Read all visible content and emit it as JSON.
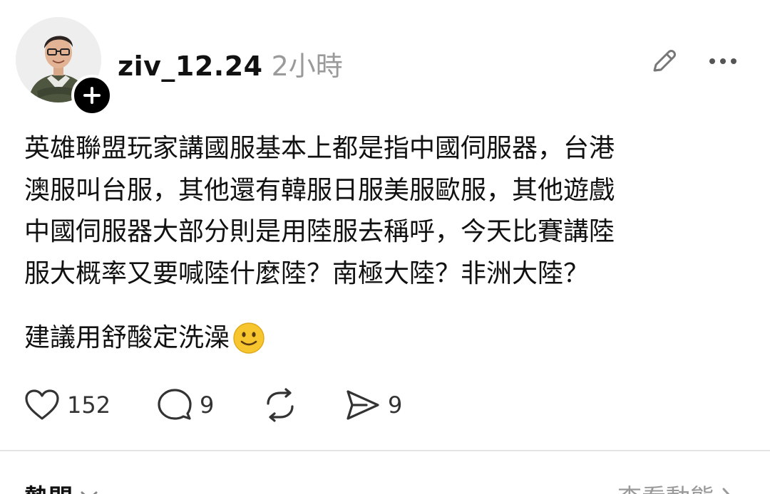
{
  "post": {
    "username": "ziv_12.24",
    "timestamp": "2小時",
    "body_lines": [
      "英雄聯盟玩家講國服基本上都是指中國伺服器，台港",
      "澳服叫台服，其他還有韓服日服美服歐服，其他遊戲",
      "中國伺服器大部分則是用陸服去稱呼，今天比賽講陸",
      "服大概率又要喊陸什麼陸？南極大陸？非洲大陸？"
    ],
    "second_paragraph": "建議用舒酸定洗澡",
    "emoji_icon": "slightly-smiling-face"
  },
  "actions": {
    "like_count": "152",
    "comment_count": "9",
    "repost_count": "",
    "share_count": "9"
  },
  "icons": {
    "follow": "plus-icon",
    "edit": "pencil-icon",
    "more": "ellipsis-icon",
    "like": "heart-icon",
    "comment": "speech-bubble-icon",
    "repost": "repost-icon",
    "share": "send-icon"
  },
  "footer": {
    "left_label": "熱門",
    "right_label": "查看動態"
  },
  "colors": {
    "text": "#111111",
    "muted": "#9a9a9a",
    "divider": "#e4e4e4",
    "emoji_face": "#f7c62f"
  }
}
